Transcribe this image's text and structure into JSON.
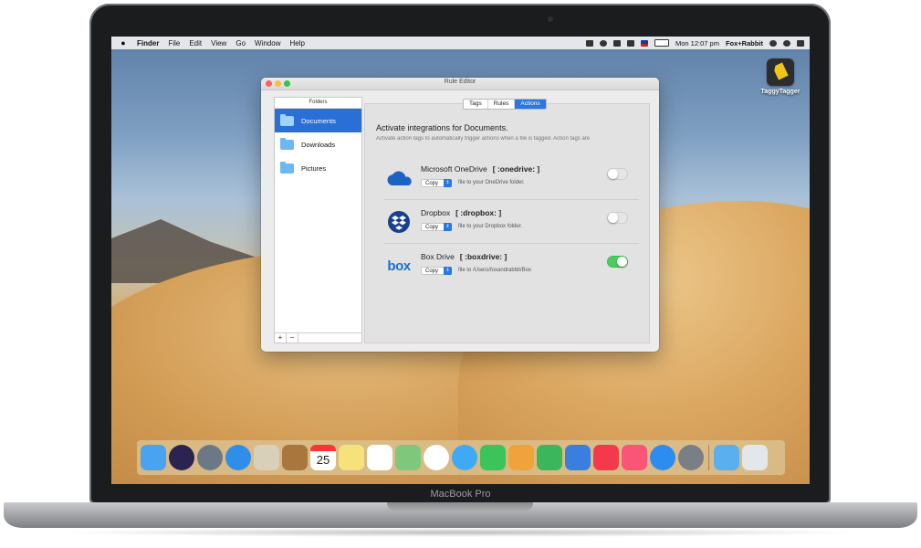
{
  "menubar": {
    "app": "Finder",
    "menus": [
      "File",
      "Edit",
      "View",
      "Go",
      "Window",
      "Help"
    ],
    "clock": "Mon 12:07 pm",
    "user": "Fox+Rabbit"
  },
  "desktop_icon": {
    "label": "TaggyTagger"
  },
  "window": {
    "title": "Rule Editor",
    "tabs": [
      "Tags",
      "Rules",
      "Actions"
    ],
    "active_tab": "Actions",
    "sidebar": {
      "header": "Folders",
      "items": [
        {
          "label": "Documents",
          "selected": true
        },
        {
          "label": "Downloads",
          "selected": false
        },
        {
          "label": "Pictures",
          "selected": false
        }
      ],
      "add_label": "+",
      "remove_label": "−"
    },
    "heading": "Activate integrations for Documents.",
    "subtext": "Activate action tags to automatically trigger actions when a file is tagged. Action tags are",
    "integrations": [
      {
        "name": "Microsoft OneDrive",
        "tag": "[ :onedrive: ]",
        "action": "Copy",
        "destination": "file to your OneDrive folder.",
        "enabled": false,
        "icon": "onedrive-icon"
      },
      {
        "name": "Dropbox",
        "tag": "[ :dropbox: ]",
        "action": "Copy",
        "destination": "file to your Dropbox folder.",
        "enabled": false,
        "icon": "dropbox-icon"
      },
      {
        "name": "Box Drive",
        "tag": "[ :boxdrive: ]",
        "action": "Copy",
        "destination": "file to /Users/foxandrabbit/Box",
        "enabled": true,
        "icon": "box-icon",
        "icon_text": "box"
      }
    ]
  },
  "laptop": {
    "model": "MacBook Pro"
  },
  "dock": {
    "icons": [
      "finder-icon",
      "siri-icon",
      "launchpad-icon",
      "safari-icon",
      "mail-stamp-icon",
      "contacts-icon",
      "calendar-icon",
      "notes-icon",
      "reminders-icon",
      "maps-icon",
      "photos-icon",
      "messages-icon",
      "facetime-icon",
      "pages-icon",
      "numbers-icon",
      "keynote-icon",
      "news-icon",
      "music-icon",
      "app-store-icon",
      "system-preferences-icon",
      "downloads-folder-icon",
      "trash-icon"
    ],
    "calendar_day": "25",
    "colors": {
      "finder": "#4aa3f0",
      "siri": "#2b2350",
      "launchpad": "#6d7887",
      "safari": "#2f8ee8",
      "mail": "#d8d0b8",
      "contacts": "#a9773e",
      "calendar": "#ffffff",
      "notes": "#f6e27a",
      "reminders": "#ffffff",
      "maps": "#7fc77a",
      "photos": "#ffffff",
      "messages": "#3fa9f5",
      "facetime": "#3bc45a",
      "pages": "#f0a33a",
      "numbers": "#3bb65a",
      "keynote": "#3a7fe0",
      "news": "#f5394d",
      "music": "#f95577",
      "appstore": "#2d8cf0",
      "prefs": "#7a7e85",
      "downloads": "#5ab0ee",
      "trash": "#e3e6ea"
    }
  }
}
